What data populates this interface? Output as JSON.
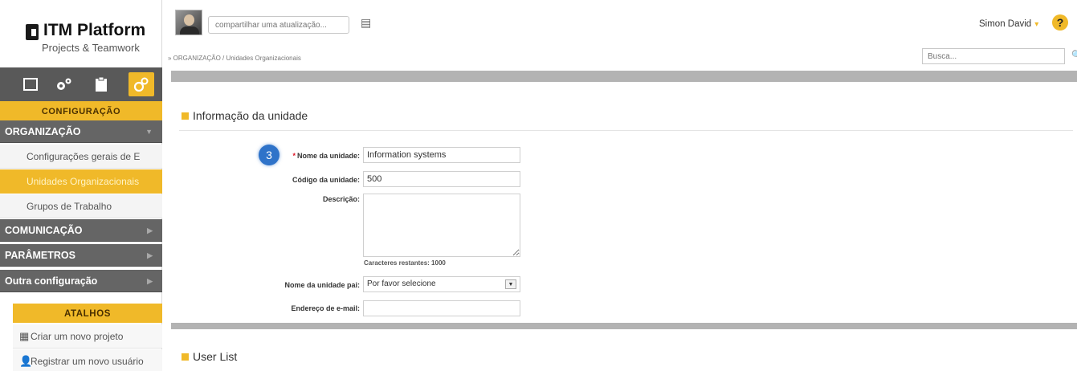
{
  "logo": {
    "title": "ITM Platform",
    "subtitle": "Projects & Teamwork"
  },
  "sidebar": {
    "icons": [
      "folder-icon",
      "gears-icon",
      "clipboard-icon",
      "settings-icon"
    ],
    "config_label": "CONFIGURAÇÃO",
    "sections": {
      "organizacao": "ORGANIZAÇÃO",
      "comunicacao": "COMUNICAÇÃO",
      "parametros": "PARÂMETROS",
      "outra": "Outra configuração"
    },
    "org_items": [
      "Configurações gerais de E",
      "Unidades Organizacionais",
      "Grupos de Trabalho"
    ],
    "atalhos_label": "ATALHOS",
    "shortcuts": [
      "Criar um novo projeto",
      "Registrar um novo usuário"
    ]
  },
  "topbar": {
    "share_placeholder": "compartilhar uma atualização...",
    "user_name": "Simon David",
    "help_label": "?"
  },
  "breadcrumb": "» ORGANIZAÇÃO / Unidades Organizacionais",
  "search": {
    "placeholder": "Busca..."
  },
  "unit_section": {
    "title": "Informação da unidade",
    "step": "3",
    "name_label": "Nome da unidade:",
    "name_value": "Information systems",
    "code_label": "Código da unidade:",
    "code_value": "500",
    "description_label": "Descrição:",
    "description_value": "",
    "chars_remaining": "Caracteres restantes: 1000",
    "parent_label": "Nome da unidade pai:",
    "parent_value": "Por favor selecione",
    "email_label": "Endereço de e-mail:",
    "email_value": ""
  },
  "user_list": {
    "title": "User List"
  },
  "colors": {
    "accent": "#f0b929",
    "sidebar_dark": "#656565",
    "badge": "#2f73c9"
  }
}
